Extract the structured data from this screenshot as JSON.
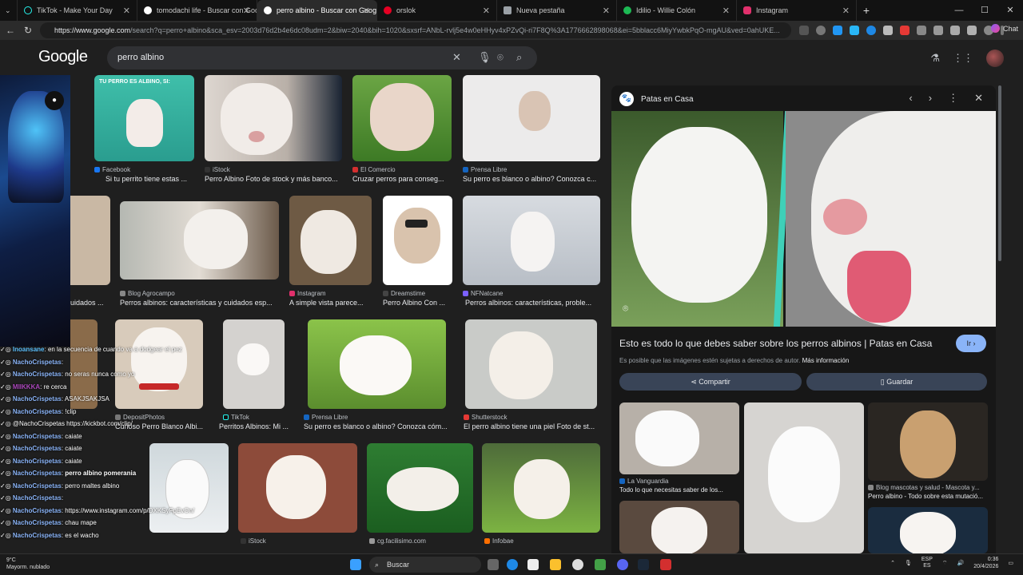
{
  "tabs": [
    {
      "label": "TikTok - Make Your Day",
      "color": "#111111"
    },
    {
      "label": "tomodachi life - Buscar con Google",
      "color": "#ffffff"
    },
    {
      "label": "perro albino - Buscar con Google",
      "color": "#ffffff"
    },
    {
      "label": "orslok",
      "color": "#e60023"
    },
    {
      "label": "Nueva pestaña",
      "color": "#9aa0a6"
    },
    {
      "label": "Idilio - Willie Colón",
      "color": "#1db954"
    },
    {
      "label": "Instagram",
      "color": "#e1306c"
    }
  ],
  "address": {
    "url_host": "https://www.google.com",
    "url_path": "/search?q=perro+albino&sca_esv=2003d76d2b4e6dc08udm=2&biw=2040&bih=1020&sxsrf=ANbL-rvlj5e4w0eHHyv4xPZvQi-ri7F8Q%3A1776662898068&ei=5bblacc6MiyYwbkPqO-mgAU&ved=0ahUKE...",
    "chat_label": "Chat"
  },
  "google": {
    "logo": "Google",
    "query": "perro albino"
  },
  "results": [
    {
      "source": "Facebook",
      "title": "Si tu perrito tiene estas ..."
    },
    {
      "source": "iStock",
      "title": "Perro Albino Foto de stock y más banco..."
    },
    {
      "source": "El Comercio",
      "title": "Cruzar perros para conseg..."
    },
    {
      "source": "Prensa Libre",
      "title": "Su perro es blanco o albino? Conozca c..."
    },
    {
      "source": "Blog Agrocampo",
      "title": "Perros albinos: características y cuidados esp..."
    },
    {
      "source": "Instagram",
      "title": "A simple vista parece..."
    },
    {
      "source": "Dreamstime",
      "title": "Perro Albino Con ..."
    },
    {
      "source": "NFNatcane",
      "title": "Perros albinos: características, proble..."
    },
    {
      "source": "DepositPhotos",
      "title": "Curioso Perro Blanco Albi..."
    },
    {
      "source": "TikTok",
      "title": "Perritos Albinos: Mi ..."
    },
    {
      "source": "Prensa Libre",
      "title": "Su perro es blanco o albino? Conozca cóm..."
    },
    {
      "source": "Shutterstock",
      "title": "El perro albino tiene una piel Foto de st..."
    },
    {
      "source": "iStock",
      "title": ""
    },
    {
      "source": "cg.facilisimo.com",
      "title": ""
    },
    {
      "source": "Infobae",
      "title": ""
    }
  ],
  "partial_captions": {
    "row2_left": "uidados ...",
    "row1_tile_text": "TU PERRO ES ALBINO, SI:"
  },
  "side": {
    "site": "Patas en Casa",
    "title": "Esto es todo lo que debes saber sobre los perros albinos | Patas en Casa",
    "go_label": "Ir",
    "note": "Es posible que las imágenes estén sujetas a derechos de autor.",
    "note_link": "Más información",
    "share_label": "Compartir",
    "save_label": "Guardar",
    "related": [
      {
        "source": "La Vanguardia",
        "title": "Todo lo que necesitas saber de los..."
      },
      {
        "source": "Blog mascotas y salud - Mascota y...",
        "title": "Perro albino - Todo sobre esta mutació..."
      }
    ]
  },
  "chat": [
    {
      "user": "lnoansane",
      "text": "en la secuencia de cuando va a dodgear el pez"
    },
    {
      "user": "NachoCrispetas",
      "text": ""
    },
    {
      "user": "NachoCrispetas",
      "text": "no seras nunca como yo"
    },
    {
      "user": "MIIKKKA",
      "text": "re cerca"
    },
    {
      "user": "NachoCrispetas",
      "text": "ASAKJSAKJSA"
    },
    {
      "user": "NachoCrispetas",
      "text": "!clip"
    },
    {
      "user": "",
      "text": "@NachoCrispetas https://kickbot.com/clip/"
    },
    {
      "user": "NachoCrispetas",
      "text": "caiate"
    },
    {
      "user": "NachoCrispetas",
      "text": "caiate"
    },
    {
      "user": "NachoCrispetas",
      "text": "caiate"
    },
    {
      "user": "NachoCrispetas",
      "text": "perro albino pomerania"
    },
    {
      "user": "NachoCrispetas",
      "text": "perro maltes albino"
    },
    {
      "user": "NachoCrispetas",
      "text": ""
    },
    {
      "user": "NachoCrispetas",
      "text": "https://www.instagram.com/p/DXKSyFpEvOn/"
    },
    {
      "user": "NachoCrispetas",
      "text": "chau mape"
    },
    {
      "user": "NachoCrispetas",
      "text": "es el wacho"
    }
  ],
  "taskbar": {
    "search_label": "Buscar",
    "weather_temp": "9°C",
    "weather_desc": "Mayorm. nublado",
    "lang": "ESP",
    "lang2": "ES",
    "time": "0:36",
    "date": "20/4/2026"
  }
}
